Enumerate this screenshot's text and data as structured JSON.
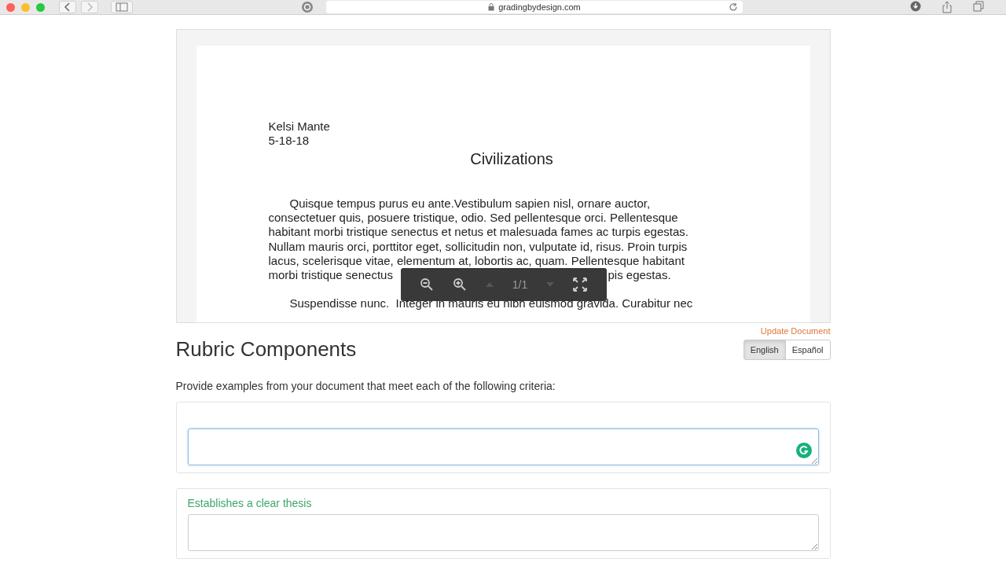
{
  "browser": {
    "url": "gradingbydesign.com"
  },
  "document": {
    "author": "Kelsi Mante",
    "date": "5-18-18",
    "title": "Civilizations",
    "paragraphs": [
      "Quisque tempus purus eu ante.Vestibulum sapien nisl, ornare auctor,\nconsectetuer quis, posuere tristique, odio. Sed pellentesque orci. Pellentesque\nhabitant morbi tristique senectus et netus et malesuada fames ac turpis egestas.\nNullam mauris orci, porttitor eget, sollicitudin non, vulputate id, risus. Proin turpis\nlacus, scelerisque vitae, elementum at, lobortis ac, quam. Pellentesque habitant\nmorbi tristique senectus",
      "Suspendisse nunc.  Integer in mauris eu nibh euismod gravida. Curabitur nec"
    ],
    "covered_fragment": "pis egestas.",
    "page_indicator": "1/1"
  },
  "update_link": "Update Document",
  "languages": [
    {
      "label": "English",
      "selected": true
    },
    {
      "label": "Español",
      "selected": false
    }
  ],
  "heading": "Rubric Components",
  "instructions": "Provide examples from your document that meet each of the following criteria:",
  "criteria": [
    {
      "focused": true
    },
    {
      "label": "Establishes a clear thesis",
      "focused": false
    }
  ]
}
